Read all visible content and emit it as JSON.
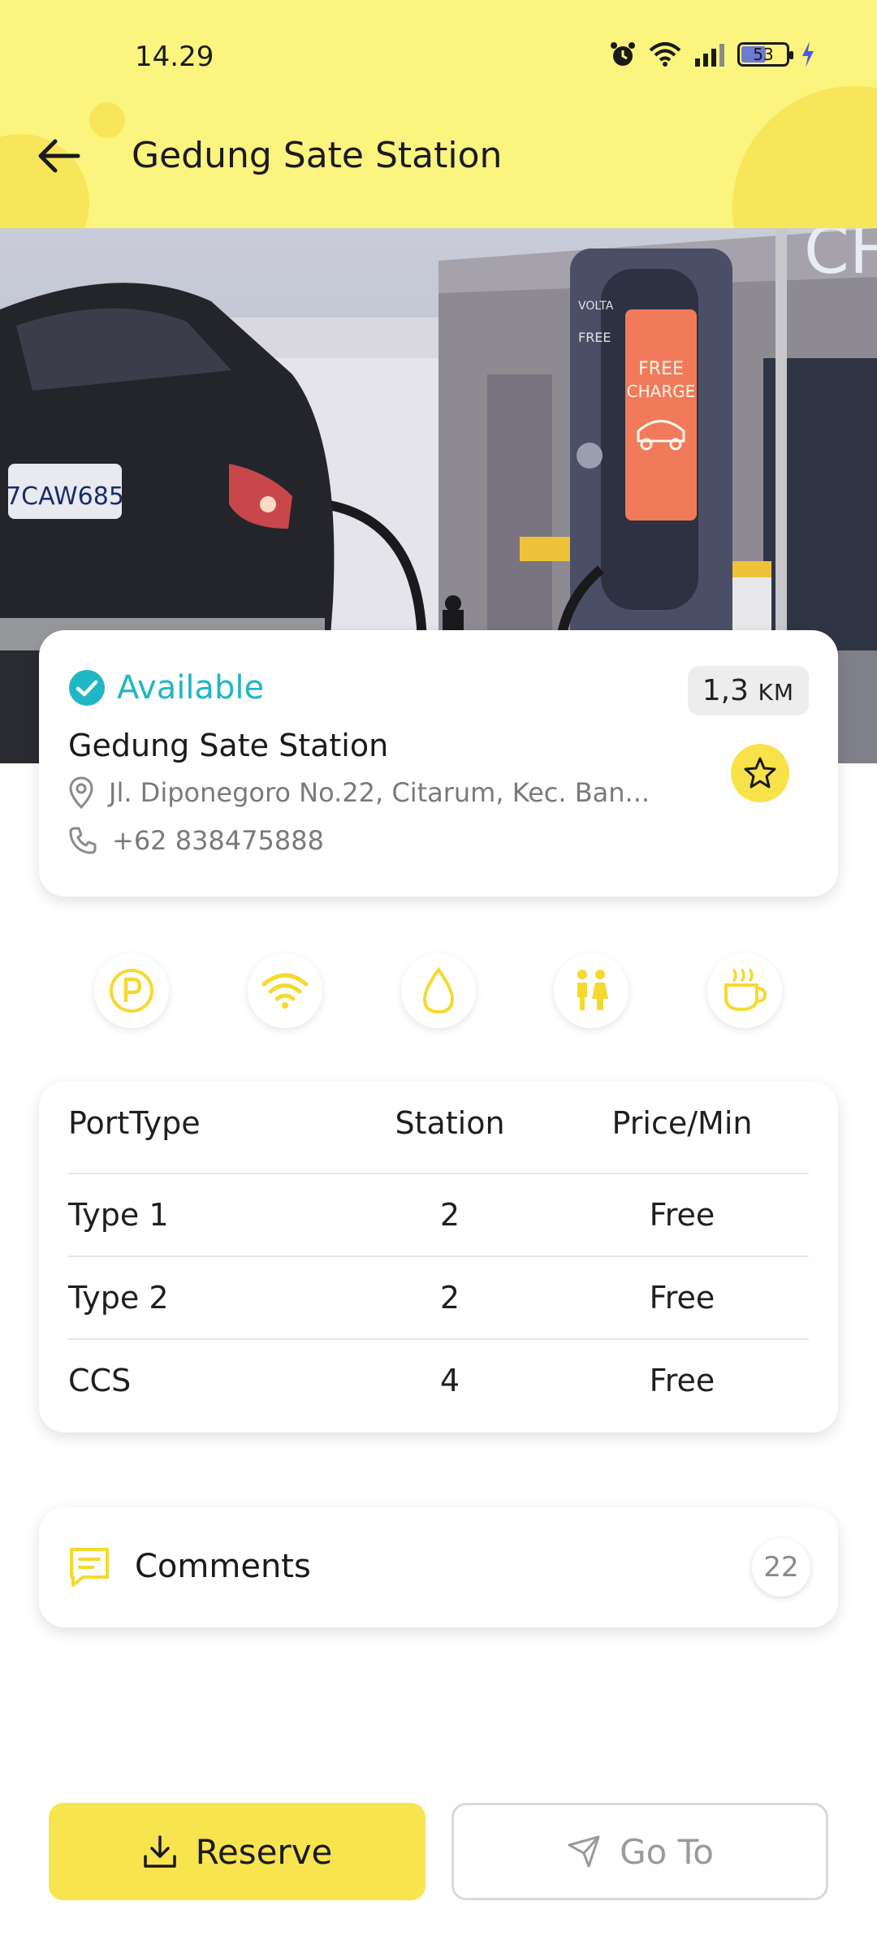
{
  "status_bar": {
    "time": "14.29",
    "battery": "53"
  },
  "header": {
    "title": "Gedung Sate Station"
  },
  "station": {
    "status": "Available",
    "distance_value": "1,3",
    "distance_unit": "KM",
    "name": "Gedung Sate Station",
    "address": "Jl. Diponegoro No.22, Citarum, Kec. Ban...",
    "phone": "+62 838475888"
  },
  "hero_image": {
    "plate_text": "7CAW685",
    "charger_brand": "VOLTA",
    "charger_label": "FREE",
    "screen_line1": "FREE",
    "screen_line2": "CHARGE"
  },
  "amenities": [
    "parking-icon",
    "wifi-icon",
    "water-icon",
    "restroom-icon",
    "cafe-icon"
  ],
  "ports_table": {
    "headers": [
      "PortType",
      "Station",
      "Price/Min"
    ],
    "rows": [
      {
        "type": "Type 1",
        "stations": "2",
        "price": "Free"
      },
      {
        "type": "Type 2",
        "stations": "2",
        "price": "Free"
      },
      {
        "type": "CCS",
        "stations": "4",
        "price": "Free"
      }
    ]
  },
  "comments": {
    "label": "Comments",
    "count": "22"
  },
  "actions": {
    "reserve_label": "Reserve",
    "goto_label": "Go To"
  },
  "colors": {
    "header_bg": "#fbf47e",
    "accent_yellow": "#f8e44f",
    "available_teal": "#21b6c4"
  }
}
